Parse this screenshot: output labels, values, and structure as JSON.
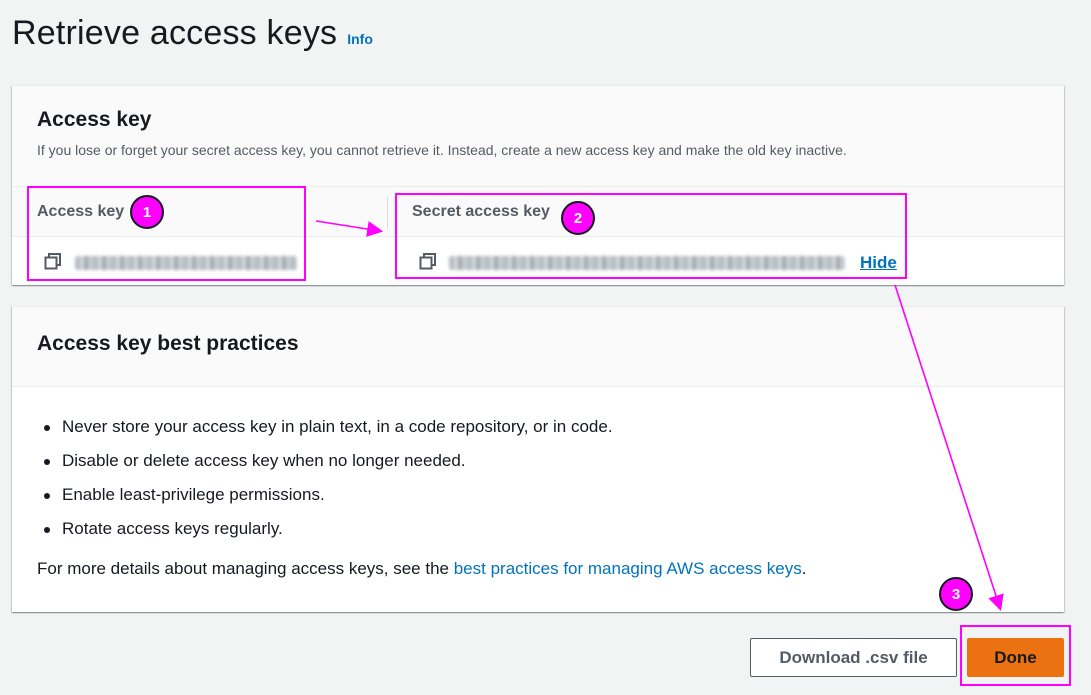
{
  "page": {
    "title": "Retrieve access keys",
    "info_link": "Info"
  },
  "access_key_panel": {
    "title": "Access key",
    "description": "If you lose or forget your secret access key, you cannot retrieve it. Instead, create a new access key and make the old key inactive.",
    "access_key_label": "Access key",
    "secret_key_label": "Secret access key",
    "hide_link": "Hide",
    "copy_icon": "copy-icon"
  },
  "best_practices_panel": {
    "title": "Access key best practices",
    "items": [
      "Never store your access key in plain text, in a code repository, or in code.",
      "Disable or delete access key when no longer needed.",
      "Enable least-privilege permissions.",
      "Rotate access keys regularly."
    ],
    "more_prefix": "For more details about managing access keys, see the ",
    "more_link": "best practices for managing AWS access keys",
    "more_suffix": "."
  },
  "buttons": {
    "download_csv": "Download .csv file",
    "done": "Done"
  },
  "annotations": {
    "badges": [
      "1",
      "2",
      "3"
    ],
    "highlight_color": "#ff00ff"
  },
  "colors": {
    "accent": "#0073bb",
    "primary_button": "#ec7211",
    "background": "#f2f3f3"
  }
}
